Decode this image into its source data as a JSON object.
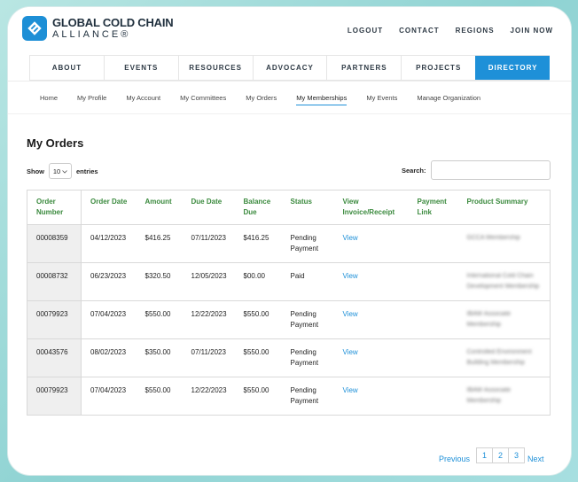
{
  "brand": {
    "line1": "GLOBAL COLD CHAIN",
    "line2": "ALLIANCE®",
    "accent": "#1e90d8",
    "green": "#3b8a3e"
  },
  "utility_nav": [
    "LOGOUT",
    "CONTACT",
    "REGIONS",
    "JOIN NOW"
  ],
  "main_nav": [
    "ABOUT",
    "EVENTS",
    "RESOURCES",
    "ADVOCACY",
    "PARTNERS",
    "PROJECTS",
    "DIRECTORY"
  ],
  "main_nav_active": "DIRECTORY",
  "sub_nav": [
    "Home",
    "My Profile",
    "My Account",
    "My Committees",
    "My Orders",
    "My Memberships",
    "My Events",
    "Manage Organization"
  ],
  "sub_nav_active": "My Memberships",
  "page_title": "My Orders",
  "length": {
    "show": "Show",
    "value": "10",
    "entries": "entries"
  },
  "search": {
    "label": "Search:",
    "value": ""
  },
  "table": {
    "headers": [
      "Order Number",
      "Order Date",
      "Amount",
      "Due Date",
      "Balance Due",
      "Status",
      "View Invoice/Receipt",
      "Payment Link",
      "Product Summary"
    ],
    "rows": [
      {
        "order": "00008359",
        "date": "04/12/2023",
        "amount": "$416.25",
        "due": "07/11/2023",
        "balance": "$416.25",
        "status": "Pending Payment",
        "view": "View",
        "link": "",
        "summary": "GCCA Membership"
      },
      {
        "order": "00008732",
        "date": "06/23/2023",
        "amount": "$320.50",
        "due": "12/05/2023",
        "balance": "$00.00",
        "status": "Paid",
        "view": "View",
        "link": "",
        "summary": "International Cold Chain Development Membership"
      },
      {
        "order": "00079923",
        "date": "07/04/2023",
        "amount": "$550.00",
        "due": "12/22/2023",
        "balance": "$550.00",
        "status": "Pending Payment",
        "view": "View",
        "link": "",
        "summary": "IBAW Associate Membership"
      },
      {
        "order": "00043576",
        "date": "08/02/2023",
        "amount": "$350.00",
        "due": "07/11/2023",
        "balance": "$550.00",
        "status": "Pending Payment",
        "view": "View",
        "link": "",
        "summary": "Controlled Environment Building Membership"
      },
      {
        "order": "00079923",
        "date": "07/04/2023",
        "amount": "$550.00",
        "due": "12/22/2023",
        "balance": "$550.00",
        "status": "Pending Payment",
        "view": "View",
        "link": "",
        "summary": "IBAW Associate Membership"
      }
    ]
  },
  "pagination": {
    "previous": "Previous",
    "pages": [
      "1",
      "2",
      "3"
    ],
    "next": "Next"
  }
}
